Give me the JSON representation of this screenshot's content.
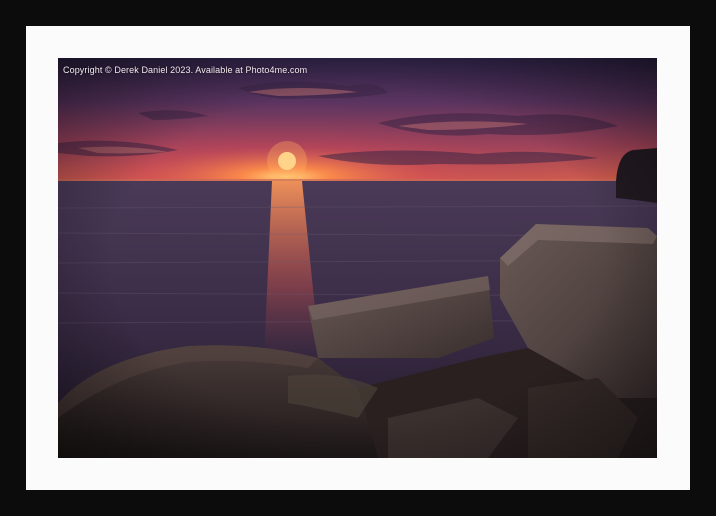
{
  "watermark": {
    "text": "Copyright © Derek Daniel 2023. Available at Photo4me.com"
  },
  "photo": {
    "subject": "sunset-over-sea-with-rocks"
  },
  "colors": {
    "frame": "#0c0c0c",
    "mount": "#fbfbfb"
  }
}
